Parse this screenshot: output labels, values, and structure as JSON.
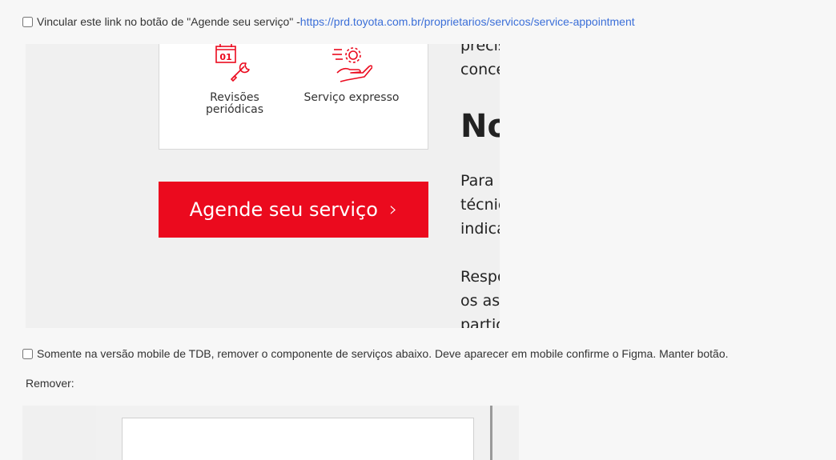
{
  "row1": {
    "label": "Vincular este link no botão de \"Agende seu serviço\" - ",
    "link": "https://prd.toyota.com.br/proprietarios/servicos/service-appointment",
    "checked": false
  },
  "shot1": {
    "services": [
      {
        "icon": "calendar-wrench-icon",
        "label": "Revisões periódicas",
        "calendar_day": "01"
      },
      {
        "icon": "hand-gear-icon",
        "label": "Serviço expresso"
      }
    ],
    "button_label": "Agende seu serviço",
    "button_chevron": "›",
    "right_column": {
      "line1": "precis",
      "line2": "conce",
      "heading": "No",
      "line3": "Para i",
      "line4": "técnic",
      "line5": "indica",
      "line6": "Respo",
      "line7": "os as",
      "line8": "partic"
    },
    "accent_color": "#eb0a1e"
  },
  "row2": {
    "label": "Somente na versão mobile de TDB, remover o componente de serviços abaixo. Deve aparecer em mobile confirme o Figma. Manter botão.",
    "checked": false
  },
  "remove_label": "Remover:"
}
